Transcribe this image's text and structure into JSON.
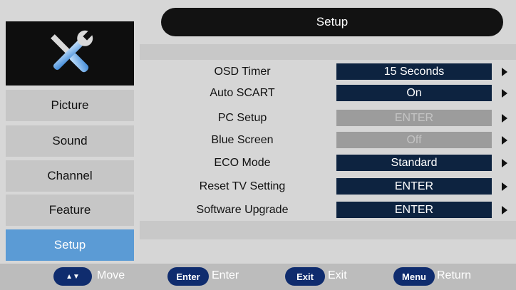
{
  "title": "Setup",
  "sidebar": {
    "logo_icon": "tools-icon",
    "items": [
      {
        "label": "Picture"
      },
      {
        "label": "Sound"
      },
      {
        "label": "Channel"
      },
      {
        "label": "Feature"
      },
      {
        "label": "Setup",
        "active": true
      }
    ]
  },
  "settings": [
    {
      "label": "OSD Timer",
      "value": "15 Seconds",
      "enabled": true
    },
    {
      "label": "Auto SCART",
      "value": "On",
      "enabled": true
    },
    {
      "label": "PC Setup",
      "value": "ENTER",
      "enabled": false
    },
    {
      "label": "Blue Screen",
      "value": "Off",
      "enabled": false
    },
    {
      "label": "ECO Mode",
      "value": "Standard",
      "enabled": true
    },
    {
      "label": "Reset TV Setting",
      "value": "ENTER",
      "enabled": true
    },
    {
      "label": "Software Upgrade",
      "value": "ENTER",
      "enabled": true
    }
  ],
  "footer": {
    "move": {
      "key": "▲▼",
      "label": "Move"
    },
    "enter": {
      "key": "Enter",
      "label": "Enter"
    },
    "exit": {
      "key": "Exit",
      "label": "Exit"
    },
    "menu": {
      "key": "Menu",
      "label": "Return"
    }
  },
  "colors": {
    "active": "#5b9bd5",
    "value_bg": "#0d2340",
    "disabled_bg": "#9c9c9c",
    "key_bg": "#0f2c6e"
  }
}
